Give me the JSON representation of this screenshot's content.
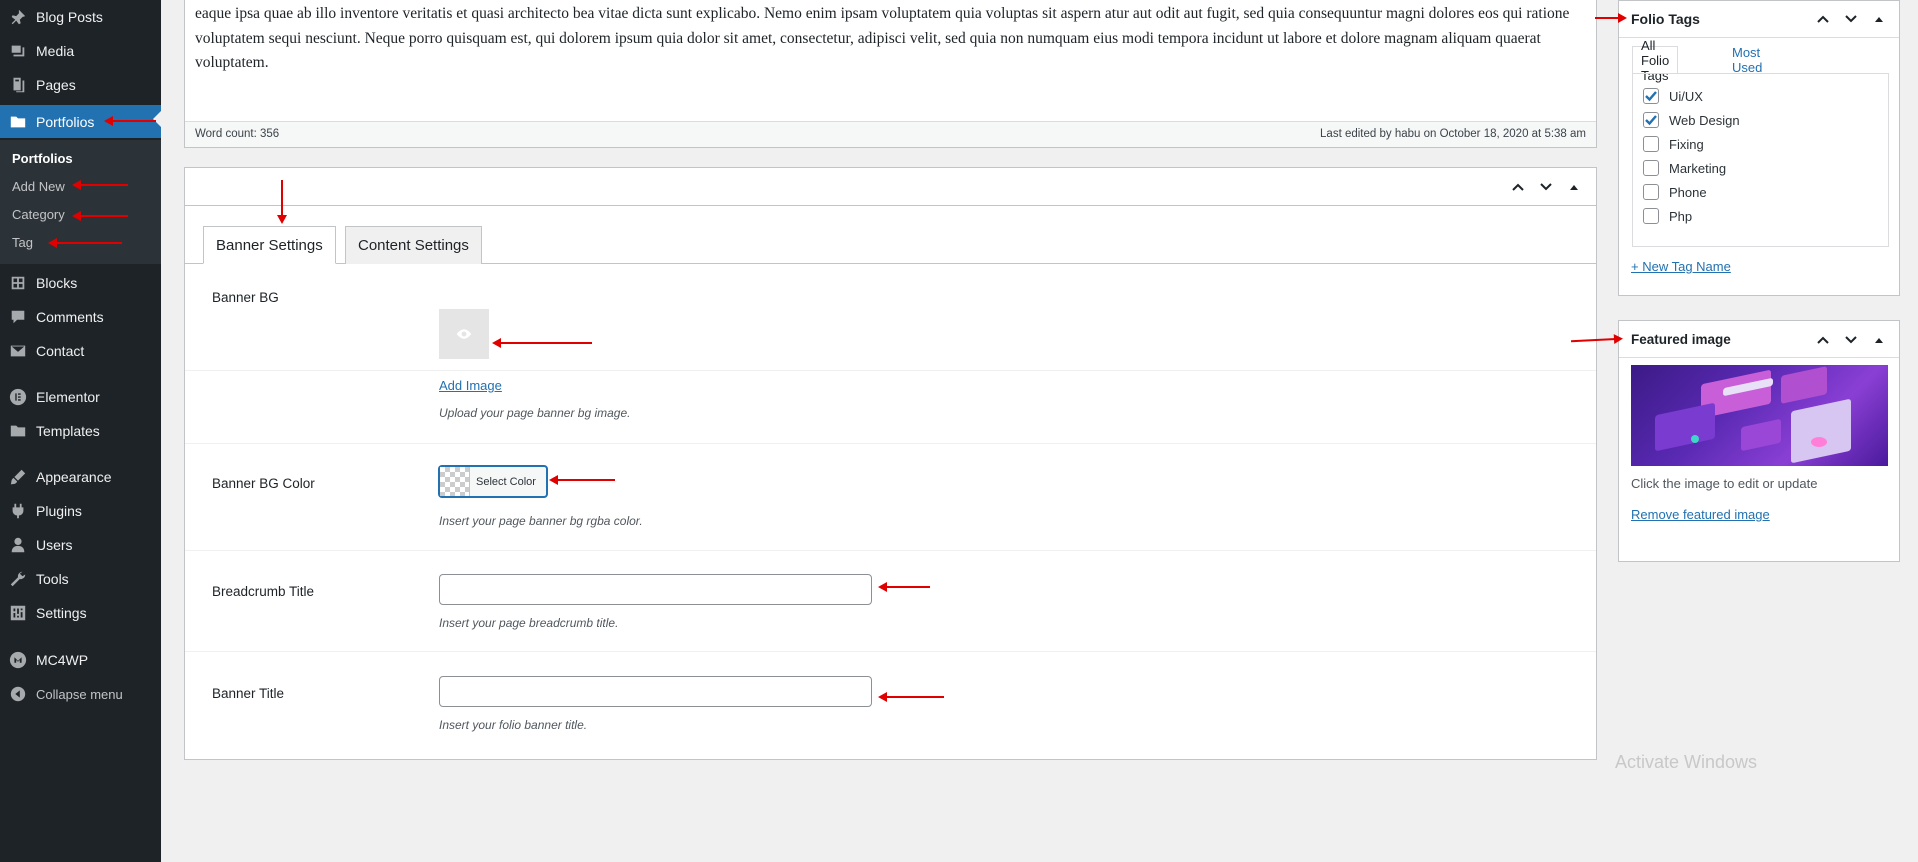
{
  "sidebar": {
    "items": [
      {
        "label": "Blog Posts",
        "icon": "pin-icon"
      },
      {
        "label": "Media",
        "icon": "media-icon"
      },
      {
        "label": "Pages",
        "icon": "pages-icon"
      },
      {
        "label": "Portfolios",
        "icon": "folder-icon"
      },
      {
        "label": "Blocks",
        "icon": "blocks-icon"
      },
      {
        "label": "Comments",
        "icon": "comments-icon"
      },
      {
        "label": "Contact",
        "icon": "mail-icon"
      },
      {
        "label": "Elementor",
        "icon": "elementor-icon"
      },
      {
        "label": "Templates",
        "icon": "folder-icon"
      },
      {
        "label": "Appearance",
        "icon": "brush-icon"
      },
      {
        "label": "Plugins",
        "icon": "plugin-icon"
      },
      {
        "label": "Users",
        "icon": "user-icon"
      },
      {
        "label": "Tools",
        "icon": "wrench-icon"
      },
      {
        "label": "Settings",
        "icon": "settings-icon"
      },
      {
        "label": "MC4WP",
        "icon": "mc4wp-icon"
      },
      {
        "label": "Collapse menu",
        "icon": "collapse-icon"
      }
    ],
    "active_item": "Portfolios",
    "submenu": [
      "Portfolios",
      "Add New",
      "Category",
      "Tag"
    ]
  },
  "editor": {
    "text": "eaque ipsa quae ab illo inventore veritatis et quasi architecto bea vitae dicta sunt explicabo. Nemo enim ipsam voluptatem quia voluptas sit aspern atur aut odit aut fugit, sed quia consequuntur magni dolores eos qui ratione voluptatem sequi nesciunt. Neque porro quisquam est, qui dolorem ipsum quia dolor sit amet, consectetur, adipisci velit, sed quia non numquam eius modi tempora incidunt ut labore et dolore magnam aliquam quaerat voluptatem.",
    "word_count": "Word count: 356",
    "last_edited": "Last edited by habu on October 18, 2020 at 5:38 am"
  },
  "settings": {
    "tabs": [
      "Banner Settings",
      "Content Settings"
    ],
    "active_tab": "Banner Settings",
    "fields": {
      "banner_bg": {
        "label": "Banner BG",
        "link": "Add Image",
        "desc": "Upload your page banner bg image."
      },
      "banner_bg_color": {
        "label": "Banner BG Color",
        "button": "Select Color",
        "desc": "Insert your page banner bg rgba color."
      },
      "breadcrumb_title": {
        "label": "Breadcrumb Title",
        "value": "",
        "desc": "Insert your page breadcrumb title."
      },
      "banner_title": {
        "label": "Banner Title",
        "value": "",
        "desc": "Insert your folio banner title."
      }
    }
  },
  "folio_tags": {
    "title": "Folio Tags",
    "tabs": [
      "All Folio Tags",
      "Most Used"
    ],
    "tags": [
      {
        "label": "Ui/UX",
        "checked": true
      },
      {
        "label": "Web Design",
        "checked": true
      },
      {
        "label": "Fixing",
        "checked": false
      },
      {
        "label": "Marketing",
        "checked": false
      },
      {
        "label": "Phone",
        "checked": false
      },
      {
        "label": "Php",
        "checked": false
      }
    ],
    "new_tag_link": "+ New Tag Name"
  },
  "featured_image": {
    "title": "Featured image",
    "hint": "Click the image to edit or update",
    "remove_link": "Remove featured image"
  },
  "watermark": "Activate Windows",
  "colors": {
    "sidebar_bg": "#1d2327",
    "submenu_bg": "#2c3338",
    "accent": "#2271b1",
    "annotation": "#e00000"
  }
}
